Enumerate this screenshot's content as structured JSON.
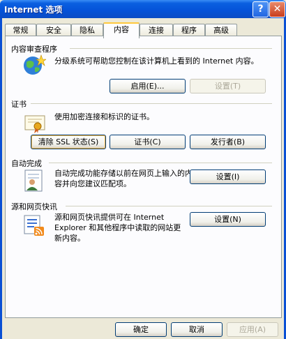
{
  "window": {
    "title": "Internet 选项",
    "help_glyph": "?",
    "close_glyph": "✕"
  },
  "tabs": [
    {
      "label": "常规"
    },
    {
      "label": "安全"
    },
    {
      "label": "隐私"
    },
    {
      "label": "内容"
    },
    {
      "label": "连接"
    },
    {
      "label": "程序"
    },
    {
      "label": "高级"
    }
  ],
  "active_tab": "内容",
  "content_advisor": {
    "title": "内容审查程序",
    "description": "分级系统可帮助您控制在该计算机上看到的 Internet 内容。",
    "enable_button": "启用(E)...",
    "settings_button": "设置(T)"
  },
  "certificates": {
    "title": "证书",
    "description": "使用加密连接和标识的证书。",
    "clear_ssl_button": "清除 SSL 状态(S)",
    "certificates_button": "证书(C)",
    "publishers_button": "发行者(B)"
  },
  "autocomplete": {
    "title": "自动完成",
    "description": "自动完成功能存储以前在网页上输入的内容并向您建议匹配项。",
    "settings_button": "设置(I)"
  },
  "feeds": {
    "title": "源和网页快讯",
    "description": "源和网页快讯提供可在 Internet Explorer 和其他程序中读取的网站更新内容。",
    "settings_button": "设置(N)"
  },
  "footer": {
    "ok": "确定",
    "cancel": "取消",
    "apply": "应用(A)"
  }
}
